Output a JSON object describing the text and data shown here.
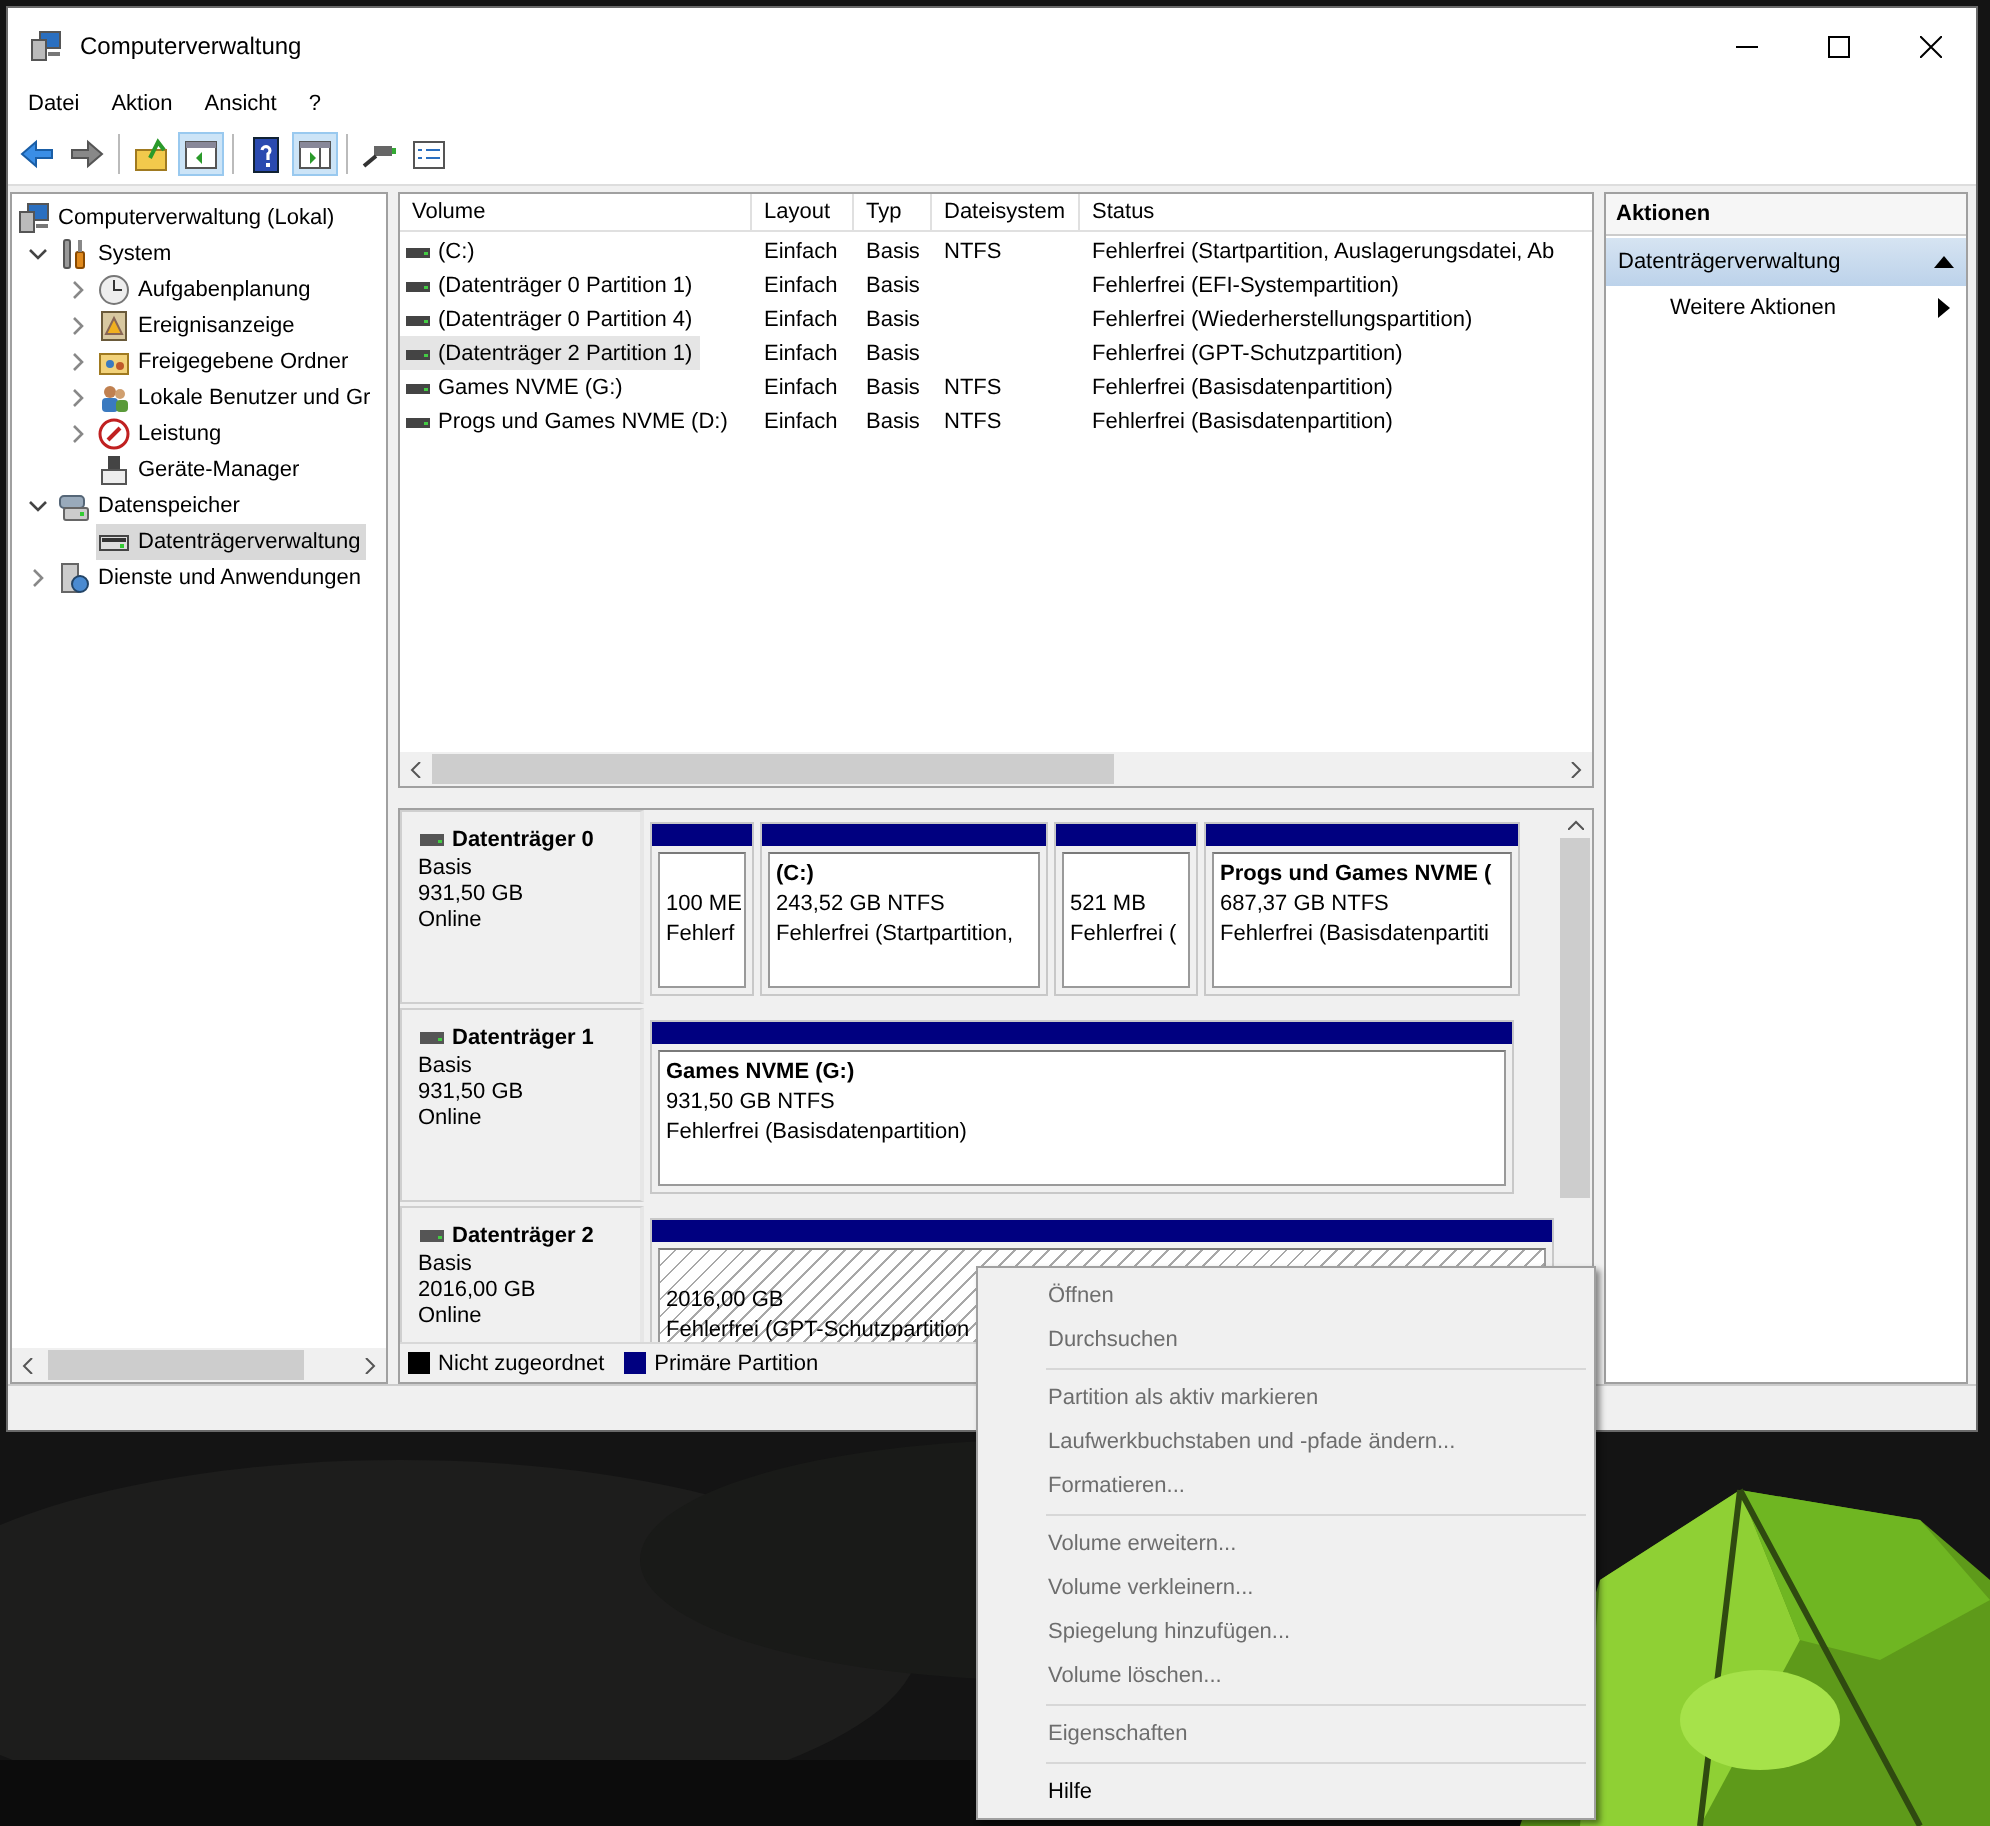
{
  "window": {
    "title": "Computerverwaltung"
  },
  "menu": [
    "Datei",
    "Aktion",
    "Ansicht",
    "?"
  ],
  "toolbar": [
    {
      "kind": "back",
      "pressed": false
    },
    {
      "kind": "forward",
      "pressed": false
    },
    {
      "kind": "sep"
    },
    {
      "kind": "up",
      "pressed": false
    },
    {
      "kind": "tree",
      "pressed": true
    },
    {
      "kind": "sep"
    },
    {
      "kind": "help",
      "pressed": false
    },
    {
      "kind": "actionpane",
      "pressed": true
    },
    {
      "kind": "sep"
    },
    {
      "kind": "connect",
      "pressed": false
    },
    {
      "kind": "properties",
      "pressed": false
    }
  ],
  "tree": [
    {
      "label": "Computerverwaltung (Lokal)",
      "selected": false,
      "children": [
        {
          "label": "System",
          "expanded": true,
          "selected": false,
          "children": [
            {
              "label": "Aufgabenplanung",
              "expanded": false,
              "selected": false
            },
            {
              "label": "Ereignisanzeige",
              "expanded": false,
              "selected": false
            },
            {
              "label": "Freigegebene Ordner",
              "expanded": false,
              "selected": false
            },
            {
              "label": "Lokale Benutzer und Gr",
              "expanded": false,
              "selected": false
            },
            {
              "label": "Leistung",
              "expanded": false,
              "selected": false
            },
            {
              "label": "Geräte-Manager",
              "selected": false
            }
          ]
        },
        {
          "label": "Datenspeicher",
          "expanded": true,
          "selected": false,
          "children": [
            {
              "label": "Datenträgerverwaltung",
              "selected": true
            }
          ]
        },
        {
          "label": "Dienste und Anwendungen",
          "expanded": false,
          "selected": false
        }
      ]
    }
  ],
  "volumes": {
    "columns": [
      "Volume",
      "Layout",
      "Typ",
      "Dateisystem",
      "Status"
    ],
    "rows": [
      {
        "selected": false,
        "cells": [
          " (C:)",
          "Einfach",
          "Basis",
          "NTFS",
          "Fehlerfrei (Startpartition, Auslagerungsdatei, Ab"
        ]
      },
      {
        "selected": false,
        "cells": [
          "(Datenträger 0 Partition 1)",
          "Einfach",
          "Basis",
          "",
          "Fehlerfrei (EFI-Systempartition)"
        ]
      },
      {
        "selected": false,
        "cells": [
          "(Datenträger 0 Partition 4)",
          "Einfach",
          "Basis",
          "",
          "Fehlerfrei (Wiederherstellungspartition)"
        ]
      },
      {
        "selected": true,
        "cells": [
          "(Datenträger 2 Partition 1)",
          "Einfach",
          "Basis",
          "",
          "Fehlerfrei (GPT-Schutzpartition)"
        ]
      },
      {
        "selected": false,
        "cells": [
          "Games NVME (G:)",
          "Einfach",
          "Basis",
          "NTFS",
          "Fehlerfrei (Basisdatenpartition)"
        ]
      },
      {
        "selected": false,
        "cells": [
          "Progs und Games NVME (D:)",
          "Einfach",
          "Basis",
          "NTFS",
          "Fehlerfrei (Basisdatenpartition)"
        ]
      }
    ]
  },
  "disks": [
    {
      "name": "Datenträger 0",
      "type": "Basis",
      "size": "931,50 GB",
      "status": "Online",
      "partitions": [
        {
          "size": "100 ME",
          "status": "Fehlerf",
          "selected": false
        },
        {
          "title": " (C:)",
          "size": "243,52 GB NTFS",
          "status": "Fehlerfrei (Startpartition,",
          "selected": false
        },
        {
          "size": "521 MB",
          "status": "Fehlerfrei (",
          "selected": false
        },
        {
          "title": "Progs und Games NVME  (",
          "size": "687,37 GB NTFS",
          "status": "Fehlerfrei (Basisdatenpartiti",
          "selected": false
        }
      ]
    },
    {
      "name": "Datenträger 1",
      "type": "Basis",
      "size": "931,50 GB",
      "status": "Online",
      "partitions": [
        {
          "title": "Games NVME  (G:)",
          "size": "931,50 GB NTFS",
          "status": "Fehlerfrei (Basisdatenpartition)",
          "selected": false
        }
      ]
    },
    {
      "name": "Datenträger 2",
      "type": "Basis",
      "size": "2016,00 GB",
      "status": "Online",
      "partitions": [
        {
          "size": "2016,00 GB",
          "status": "Fehlerfrei (GPT-Schutzpartition",
          "selected": true
        }
      ]
    }
  ],
  "legend": [
    {
      "label": "Nicht zugeordnet",
      "color": "#000000"
    },
    {
      "label": "Primäre Partition",
      "color": "#000080"
    }
  ],
  "actions": {
    "title": "Aktionen",
    "sections": [
      {
        "label": "Datenträgerverwaltung",
        "expanded": true,
        "items": [
          "Weitere Aktionen"
        ]
      }
    ]
  },
  "context_menu": [
    [
      {
        "label": "Öffnen",
        "disabled": true
      },
      {
        "label": "Durchsuchen",
        "disabled": true
      }
    ],
    [
      {
        "label": "Partition als aktiv markieren",
        "disabled": true
      },
      {
        "label": "Laufwerkbuchstaben und -pfade ändern...",
        "disabled": true
      },
      {
        "label": "Formatieren...",
        "disabled": true
      }
    ],
    [
      {
        "label": "Volume erweitern...",
        "disabled": true
      },
      {
        "label": "Volume verkleinern...",
        "disabled": true
      },
      {
        "label": "Spiegelung hinzufügen...",
        "disabled": true
      },
      {
        "label": "Volume löschen...",
        "disabled": true
      }
    ],
    [
      {
        "label": "Eigenschaften",
        "disabled": true
      }
    ],
    [
      {
        "label": "Hilfe",
        "disabled": false
      }
    ]
  ]
}
